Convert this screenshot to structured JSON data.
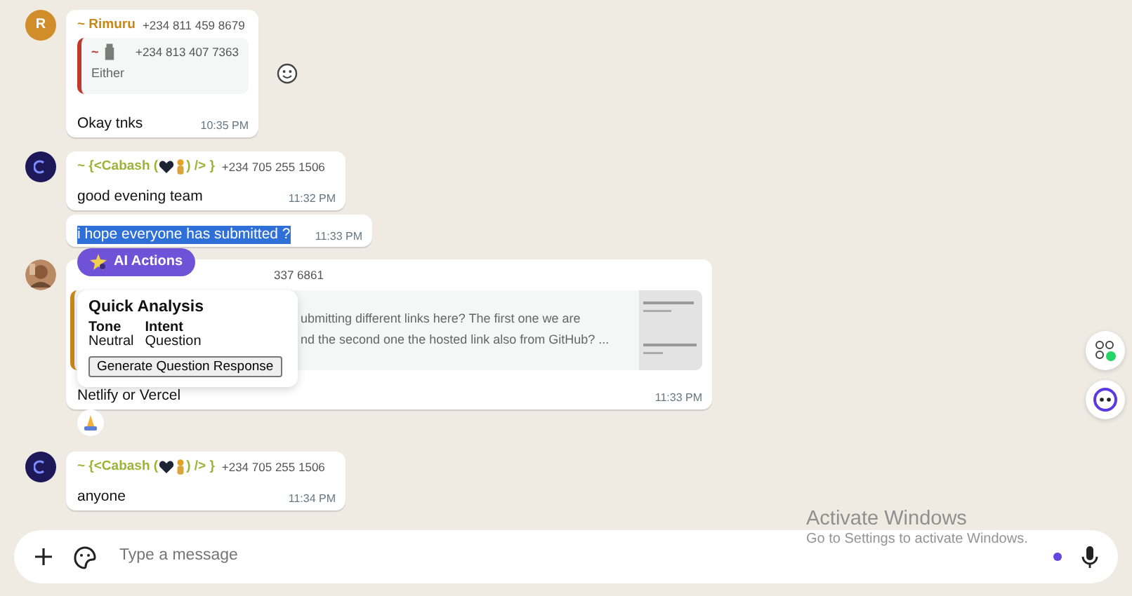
{
  "messages": [
    {
      "kind": "quoted",
      "avatar": {
        "kind": "letter",
        "letter": "R"
      },
      "sender": "~ Rimuru",
      "phone": "+234 811 459 8679",
      "color": "#c88719",
      "quote": {
        "sender": "~",
        "phone": "+234 813 407 7363",
        "text": "Either",
        "color": "#c0392b"
      },
      "text": "Okay tnks",
      "time": "10:35 PM",
      "react_button": true
    },
    {
      "kind": "plain",
      "avatar": {
        "kind": "logo"
      },
      "sender_parts": [
        "~ {<Cabash (",
        ") /> }"
      ],
      "phone": "+234 705 255 1506",
      "color": "#9ab534",
      "text": "good evening team",
      "time": "11:32 PM"
    },
    {
      "kind": "continued",
      "text": "i hope everyone has submitted ?",
      "selected": true,
      "time": "11:33 PM"
    },
    {
      "kind": "covered",
      "phone": "337 6861",
      "quote": {
        "lines": [
          "ubmitting different links here? The first one we are",
          "nd the second one the hosted link also from GitHub? ..."
        ],
        "color": "#c88719"
      },
      "text": "Netlify or Vercel",
      "time": "11:33 PM",
      "reaction": true
    },
    {
      "kind": "plain",
      "avatar": {
        "kind": "logo"
      },
      "sender_parts": [
        "~ {<Cabash (",
        ") /> }"
      ],
      "phone": "+234 705 255 1506",
      "color": "#9ab534",
      "text": "anyone",
      "time": "11:34 PM"
    }
  ],
  "ai_actions": {
    "label": "AI Actions"
  },
  "analysis": {
    "title": "Quick Analysis",
    "fields": [
      {
        "label": "Tone",
        "value": "Neutral"
      },
      {
        "label": "Intent",
        "value": "Question"
      }
    ],
    "button": "Generate Question Response"
  },
  "composer": {
    "placeholder": "Type a message"
  },
  "activation": {
    "title": "Activate Windows",
    "text": "Go to Settings to activate Windows."
  }
}
